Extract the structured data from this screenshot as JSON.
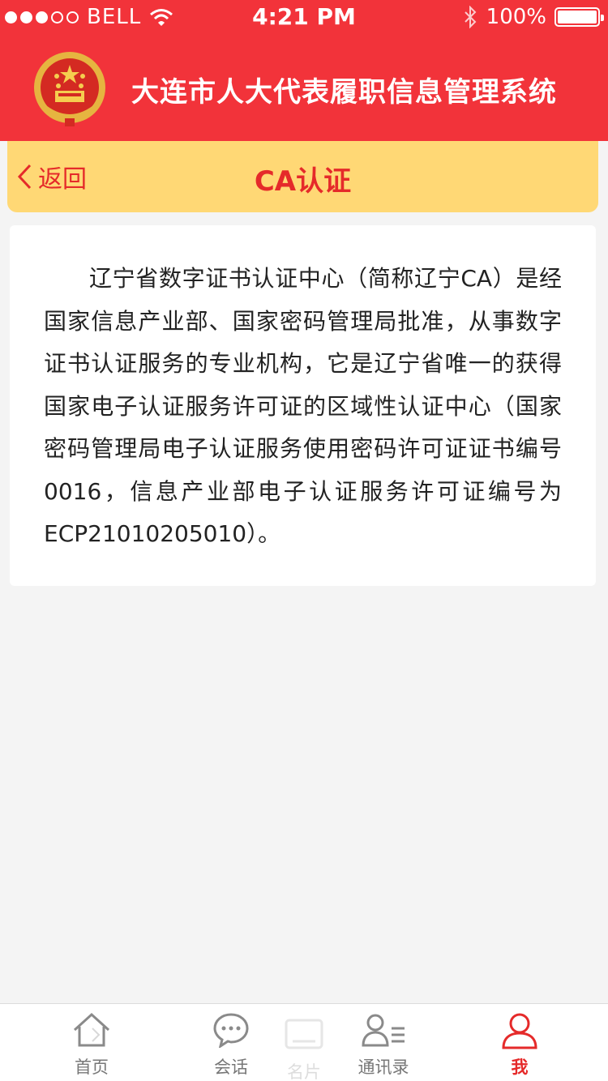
{
  "status_bar": {
    "carrier": "BELL",
    "time": "4:21 PM",
    "battery": "100%"
  },
  "app": {
    "title": "大连市人大代表履职信息管理系统"
  },
  "nav": {
    "back_label": "返回",
    "title": "CA认证"
  },
  "content": {
    "paragraph": "辽宁省数字证书认证中心（简称辽宁CA）是经国家信息产业部、国家密码管理局批准，从事数字证书认证服务的专业机构，它是辽宁省唯一的获得国家电子认证服务许可证的区域性认证中心（国家密码管理局电子认证服务使用密码许可证证书编号0016，信息产业部电子认证服务许可证编号为ECP21010205010）。"
  },
  "tabs": [
    {
      "label": "首页",
      "icon": "home-icon"
    },
    {
      "label": "会话",
      "icon": "chat-icon"
    },
    {
      "label": "名片",
      "icon": "card-icon"
    },
    {
      "label": "通讯录",
      "icon": "contacts-icon"
    },
    {
      "label": "我",
      "icon": "user-icon",
      "active": true
    }
  ],
  "colors": {
    "header_red": "#f2333a",
    "nav_yellow": "#ffd875",
    "accent_red": "#e52a2a"
  }
}
